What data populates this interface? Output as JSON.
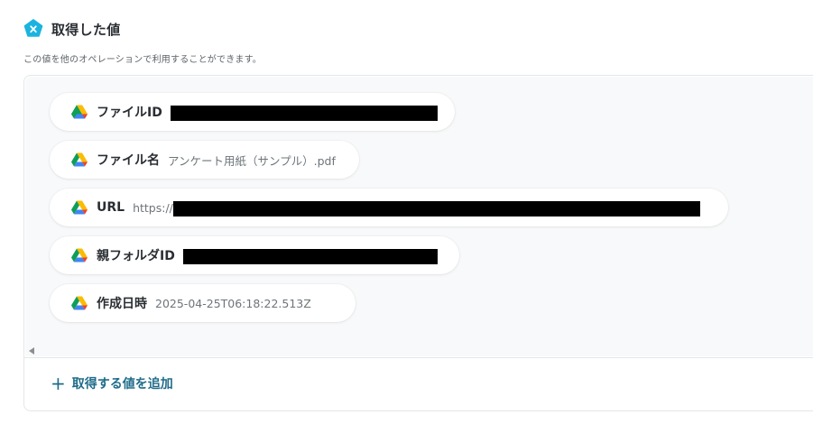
{
  "header": {
    "title": "取得した値",
    "icon": "variable-badge-icon",
    "icon_color": "#1ab3e0"
  },
  "description": "この値を他のオペレーションで利用することができます。",
  "fields": [
    {
      "label": "ファイルID",
      "value": "",
      "redacted": true
    },
    {
      "label": "ファイル名",
      "value": "アンケート用紙（サンプル）.pdf",
      "redacted": false
    },
    {
      "label": "URL",
      "value": "https://",
      "redacted": true
    },
    {
      "label": "親フォルダID",
      "value": "",
      "redacted": true
    },
    {
      "label": "作成日時",
      "value": "2025-04-25T06:18:22.513Z",
      "redacted": false
    }
  ],
  "field_icon": "google-drive-icon",
  "add_button": {
    "label": "取得する値を追加",
    "icon": "plus-icon",
    "color": "#1f6c8a"
  }
}
